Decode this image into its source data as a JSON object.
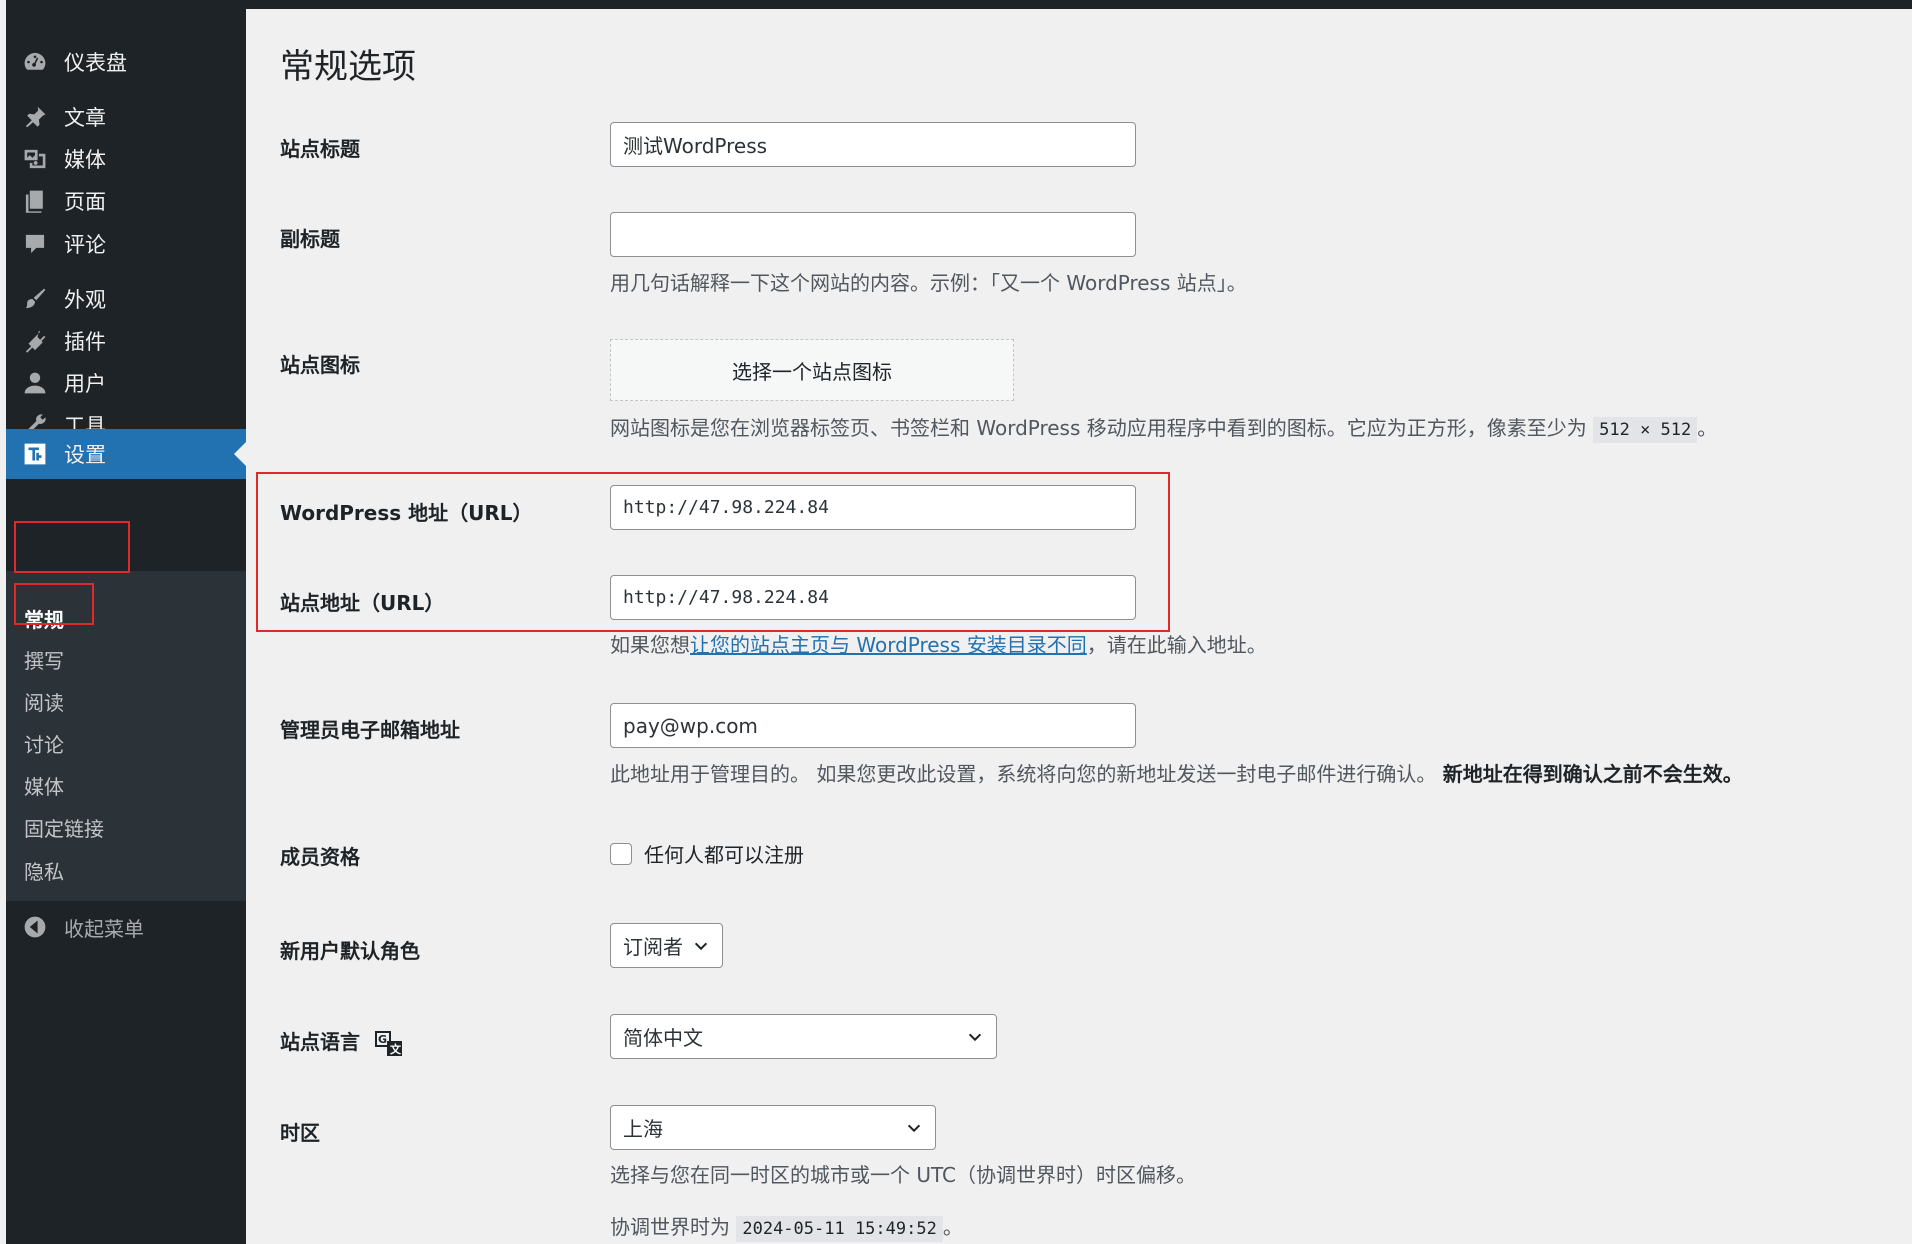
{
  "sidebar": {
    "items": [
      {
        "label": "仪表盘",
        "icon": "dashboard-icon"
      },
      {
        "label": "文章",
        "icon": "pin-icon"
      },
      {
        "label": "媒体",
        "icon": "media-icon"
      },
      {
        "label": "页面",
        "icon": "page-icon"
      },
      {
        "label": "评论",
        "icon": "comment-icon"
      },
      {
        "label": "外观",
        "icon": "brush-icon"
      },
      {
        "label": "插件",
        "icon": "plugin-icon"
      },
      {
        "label": "用户",
        "icon": "user-icon"
      },
      {
        "label": "工具",
        "icon": "wrench-icon"
      },
      {
        "label": "设置",
        "icon": "settings-icon"
      }
    ],
    "submenu": [
      "常规",
      "撰写",
      "阅读",
      "讨论",
      "媒体",
      "固定链接",
      "隐私"
    ],
    "collapse_label": "收起菜单"
  },
  "colors": {
    "sidebar_bg": "#1d2327",
    "submenu_bg": "#2c3338",
    "accent": "#2271b1",
    "highlight": "#e0292b",
    "page_bg": "#f0f0f1"
  },
  "page": {
    "title": "常规选项",
    "site_title": {
      "label": "站点标题",
      "value": "测试WordPress"
    },
    "tagline": {
      "label": "副标题",
      "value": "",
      "desc": "用几句话解释一下这个网站的内容。示例：「又一个 WordPress 站点」。"
    },
    "site_icon": {
      "label": "站点图标",
      "button": "选择一个站点图标",
      "desc_prefix": "网站图标是您在浏览器标签页、书签栏和 WordPress 移动应用程序中看到的图标。它应为正方形，像素至少为 ",
      "desc_code": "512 × 512",
      "desc_suffix": "。"
    },
    "wp_url": {
      "label": "WordPress 地址（URL）",
      "value": "http://47.98.224.84"
    },
    "site_url": {
      "label": "站点地址（URL）",
      "value": "http://47.98.224.84",
      "desc_prefix": "如果您想",
      "desc_link": "让您的站点主页与 WordPress 安装目录不同",
      "desc_suffix": "，请在此输入地址。"
    },
    "admin_email": {
      "label": "管理员电子邮箱地址",
      "value": "pay@wp.com",
      "desc": "此地址用于管理目的。 如果您更改此设置，系统将向您的新地址发送一封电子邮件进行确认。 ",
      "desc_bold": "新地址在得到确认之前不会生效。"
    },
    "membership": {
      "label": "成员资格",
      "checkbox_label": "任何人都可以注册",
      "checked": false
    },
    "default_role": {
      "label": "新用户默认角色",
      "value": "订阅者"
    },
    "language": {
      "label": "站点语言",
      "value": "简体中文",
      "icon": "translate-icon"
    },
    "timezone": {
      "label": "时区",
      "value": "上海",
      "desc": "选择与您在同一时区的城市或一个 UTC（协调世界时）时区偏移。",
      "utc_prefix": "协调世界时为 ",
      "utc_time": "2024-05-11 15:49:52",
      "utc_suffix": "。"
    }
  }
}
